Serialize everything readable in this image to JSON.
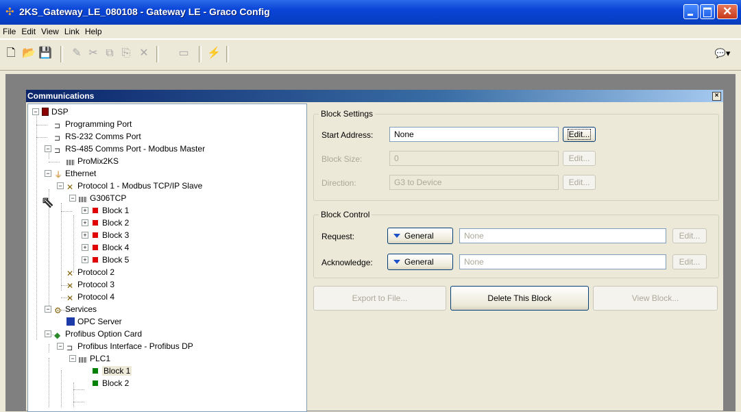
{
  "window": {
    "title": "2KS_Gateway_LE_080108 - Gateway LE - Graco Config",
    "app_icon": "network-icon",
    "buttons": {
      "minimize": "minimize-icon",
      "maximize": "maximize-icon",
      "close": "close-icon"
    }
  },
  "menubar": {
    "items": [
      "File",
      "Edit",
      "View",
      "Link",
      "Help"
    ]
  },
  "toolbar": {
    "buttons": [
      {
        "name": "new-icon",
        "glyph": "🗋",
        "enabled": true
      },
      {
        "name": "open-icon",
        "glyph": "📂",
        "enabled": true
      },
      {
        "name": "save-icon",
        "glyph": "💾",
        "enabled": true
      },
      {
        "name": "pencil-icon",
        "glyph": "✎",
        "enabled": false
      },
      {
        "name": "cut-icon",
        "glyph": "✂",
        "enabled": false
      },
      {
        "name": "copy-icon",
        "glyph": "⧉",
        "enabled": false
      },
      {
        "name": "paste-icon",
        "glyph": "📋",
        "enabled": false
      },
      {
        "name": "delete-icon",
        "glyph": "✕",
        "enabled": false
      },
      {
        "name": "window-icon",
        "glyph": "▭",
        "enabled": false
      },
      {
        "name": "lightning-icon",
        "glyph": "⚡",
        "enabled": true
      }
    ],
    "right_icon": "comment-icon"
  },
  "panel": {
    "title": "Communications"
  },
  "tree": [
    {
      "label": "DSP",
      "icon": "dsp-icon",
      "level": 0,
      "exp": "-"
    },
    {
      "label": "Programming Port",
      "icon": "port-icon",
      "level": 1,
      "exp": ""
    },
    {
      "label": "RS-232 Comms Port",
      "icon": "port-icon",
      "level": 1,
      "exp": ""
    },
    {
      "label": "RS-485 Comms Port - Modbus Master",
      "icon": "port-icon",
      "level": 1,
      "exp": "-"
    },
    {
      "label": "ProMix2KS",
      "icon": "device-icon",
      "level": 2,
      "exp": ""
    },
    {
      "label": "Ethernet",
      "icon": "ethernet-icon",
      "level": 1,
      "exp": "-"
    },
    {
      "label": "Protocol 1 - Modbus TCP/IP Slave",
      "icon": "protocol-icon",
      "level": 2,
      "exp": "-"
    },
    {
      "label": "G306TCP",
      "icon": "device-icon",
      "level": 3,
      "exp": "-"
    },
    {
      "label": "Block 1",
      "icon": "red-block-icon",
      "level": 4,
      "exp": "+"
    },
    {
      "label": "Block 2",
      "icon": "red-block-icon",
      "level": 4,
      "exp": "+"
    },
    {
      "label": "Block 3",
      "icon": "red-block-icon",
      "level": 4,
      "exp": "+"
    },
    {
      "label": "Block 4",
      "icon": "red-block-icon",
      "level": 4,
      "exp": "+"
    },
    {
      "label": "Block 5",
      "icon": "red-block-icon",
      "level": 4,
      "exp": "+"
    },
    {
      "label": "Protocol 2",
      "icon": "protocol-icon",
      "level": 2,
      "exp": ""
    },
    {
      "label": "Protocol 3",
      "icon": "protocol-icon",
      "level": 2,
      "exp": ""
    },
    {
      "label": "Protocol 4",
      "icon": "protocol-icon",
      "level": 2,
      "exp": ""
    },
    {
      "label": "Services",
      "icon": "services-icon",
      "level": 1,
      "exp": "-"
    },
    {
      "label": "OPC Server",
      "icon": "opc-icon",
      "level": 2,
      "exp": ""
    },
    {
      "label": "Profibus Option Card",
      "icon": "card-icon",
      "level": 1,
      "exp": "-"
    },
    {
      "label": "Profibus Interface - Profibus DP",
      "icon": "port-icon",
      "level": 2,
      "exp": "-"
    },
    {
      "label": "PLC1",
      "icon": "device-icon",
      "level": 3,
      "exp": "-"
    },
    {
      "label": "Block 1",
      "icon": "green-block-icon",
      "level": 4,
      "exp": "",
      "selected": true
    },
    {
      "label": "Block 2",
      "icon": "green-block-icon",
      "level": 4,
      "exp": ""
    }
  ],
  "block_settings": {
    "title": "Block Settings",
    "start_address": {
      "label": "Start Address:",
      "value": "None",
      "button": "Edit..."
    },
    "block_size": {
      "label": "Block Size:",
      "value": "0",
      "button": "Edit..."
    },
    "direction": {
      "label": "Direction:",
      "value": "G3 to Device",
      "button": "Edit..."
    }
  },
  "block_control": {
    "title": "Block Control",
    "request": {
      "label": "Request:",
      "dropdown": "General",
      "value": "None",
      "button": "Edit..."
    },
    "acknowledge": {
      "label": "Acknowledge:",
      "dropdown": "General",
      "value": "None",
      "button": "Edit..."
    }
  },
  "actions": {
    "export": "Export to File...",
    "delete": "Delete This Block",
    "view": "View Block..."
  },
  "colors": {
    "title_bar": "#0a44d6",
    "panel_title": "#0a246a",
    "selected_bg": "#ECE9D8",
    "red_block": "#e00000",
    "green_block": "#008000"
  }
}
